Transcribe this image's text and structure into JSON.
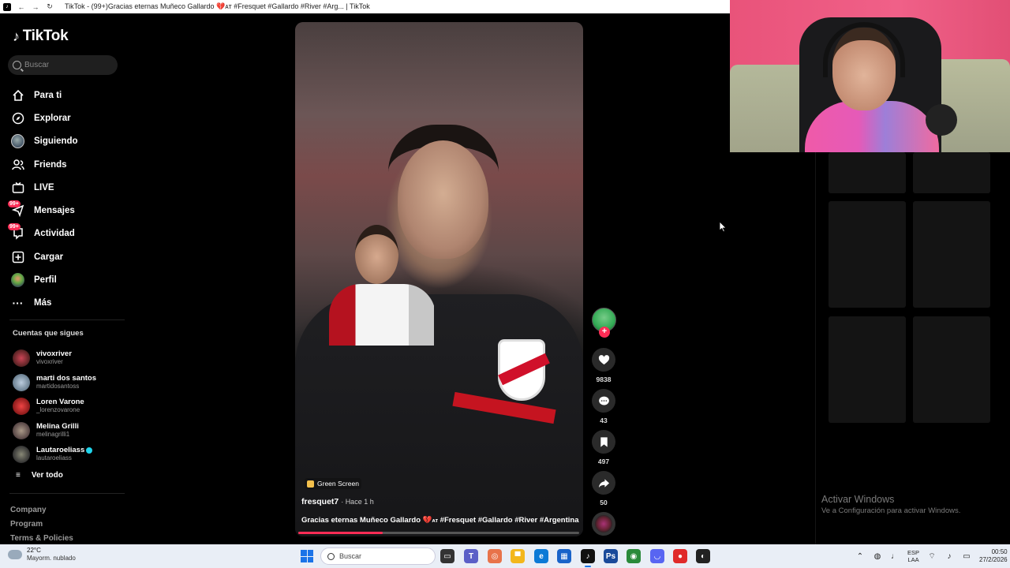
{
  "browser": {
    "tab_title": "TikTok - (99+)Gracias eternas Muñeco Gallardo 💔ᴀᴛ #Fresquet #Gallardo #River #Arg... | TikTok"
  },
  "sidebar": {
    "logo": "TikTok",
    "search_placeholder": "Buscar",
    "nav": [
      {
        "label": "Para ti",
        "icon": "home-icon"
      },
      {
        "label": "Explorar",
        "icon": "compass-icon"
      },
      {
        "label": "Siguiendo",
        "icon": "following-avatar-icon"
      },
      {
        "label": "Friends",
        "icon": "friends-icon"
      },
      {
        "label": "LIVE",
        "icon": "live-icon"
      },
      {
        "label": "Mensajes",
        "icon": "messages-icon",
        "badge": "99+"
      },
      {
        "label": "Actividad",
        "icon": "activity-icon",
        "badge": "99+"
      },
      {
        "label": "Cargar",
        "icon": "upload-icon"
      },
      {
        "label": "Perfil",
        "icon": "profile-avatar-icon"
      },
      {
        "label": "Más",
        "icon": "more-icon"
      }
    ],
    "following_title": "Cuentas que sigues",
    "following": [
      {
        "name": "vivoxriver",
        "handle": "vivoxriver",
        "color": "#7a2b3a"
      },
      {
        "name": "marti dos santos",
        "handle": "martidosantoss",
        "color": "#8aa1b5"
      },
      {
        "name": "Loren Varone",
        "handle": "_lorenzovarone",
        "color": "#b82a2a"
      },
      {
        "name": "Melina Grilli",
        "handle": "melinagrilli1",
        "color": "#6b5a55"
      },
      {
        "name": "Lautaroeliass",
        "handle": "lautaroeliass",
        "color": "#4c4a48",
        "verified": true
      }
    ],
    "see_all": "Ver todo",
    "footer": [
      "Company",
      "Program",
      "Terms & Policies"
    ]
  },
  "video": {
    "effect_tag": "Green Screen",
    "author": "fresquet7",
    "time": "Hace 1 h",
    "caption_prefix": "Gracias eternas Muñeco Gallardo ",
    "caption_emoji": "💔",
    "caption_small": "ᴀᴛ",
    "caption_tags": " #Fresquet #Gallardo #River #Argentina",
    "progress": 0.3
  },
  "actions": {
    "likes": "9838",
    "comments": "43",
    "saves": "497",
    "shares": "50"
  },
  "watermark": {
    "line1": "Activar Windows",
    "line2": "Ve a Configuración para activar Windows."
  },
  "taskbar": {
    "temp": "22°C",
    "weather": "Mayorm. nublado",
    "search_placeholder": "Buscar",
    "lang_top": "ESP",
    "lang_bottom": "LAA",
    "time": "00:50",
    "date": "27/2/2026"
  }
}
